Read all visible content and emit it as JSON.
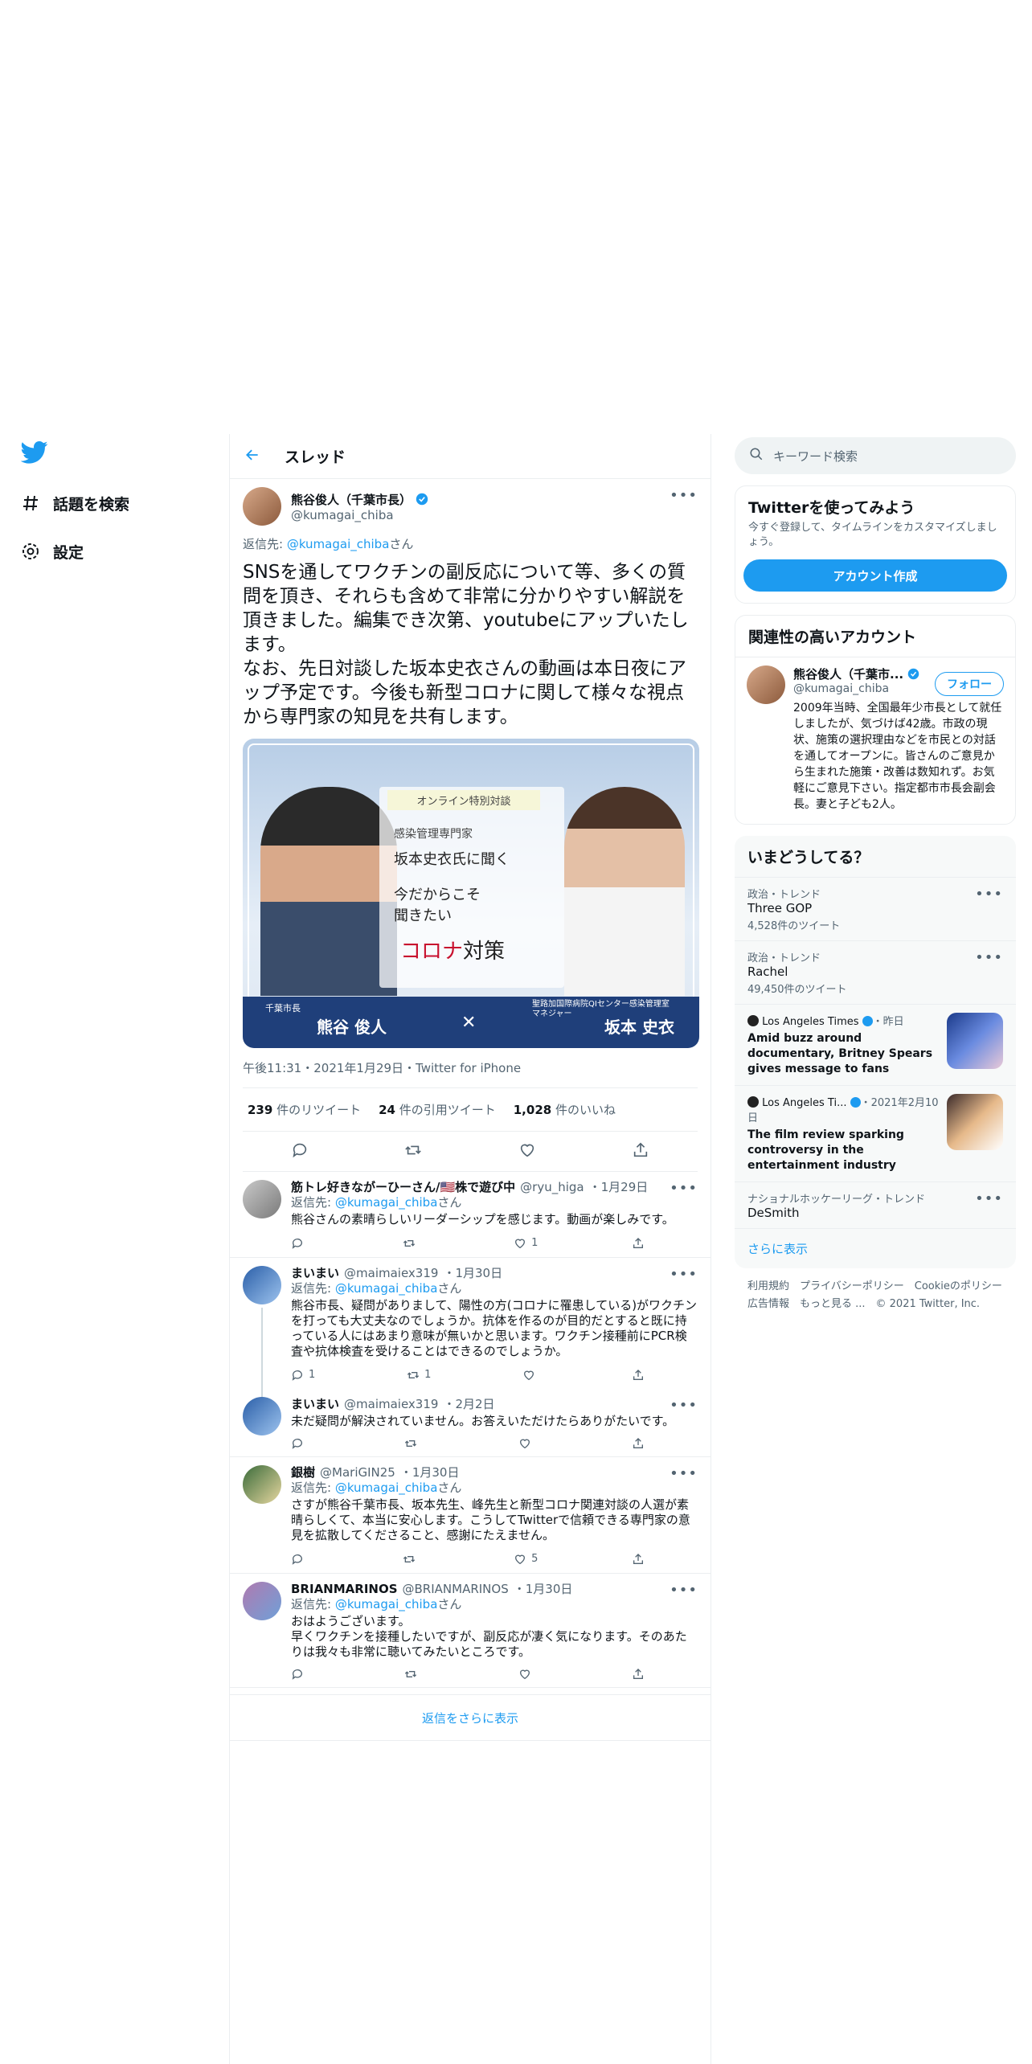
{
  "nav": {
    "search_label": "話題を検索",
    "settings_label": "設定"
  },
  "header": {
    "title": "スレッド"
  },
  "main_tweet": {
    "name": "熊谷俊人（千葉市長）",
    "handle": "@kumagai_chiba",
    "reply_prefix": "返信先: ",
    "reply_handle": "@kumagai_chiba",
    "reply_suffix": "さん",
    "text": "SNSを通してワクチンの副反応について等、多くの質問を頂き、それらも含めて非常に分かりやすい解説を頂きました。編集でき次第、youtubeにアップいたします。\nなお、先日対談した坂本史衣さんの動画は本日夜にアップ予定です。今後も新型コロナに関して様々な視点から専門家の知見を共有します。",
    "media": {
      "banner": "オンライン特別対談",
      "subtitle": "感染管理専門家",
      "headline": "坂本史衣氏に聞く",
      "line1": "今だからこそ",
      "line2": "聞きたい",
      "topic_red": "コロナ",
      "topic_black": "対策",
      "left_role": "千葉市長",
      "left_name": "熊谷 俊人",
      "x": "✕",
      "right_role": "聖路加国際病院QIセンター感染管理室\nマネジャー",
      "right_name": "坂本 史衣"
    },
    "meta": "午後11:31・2021年1月29日・Twitter for iPhone",
    "retweets": "239",
    "retweets_label": " 件のリツイート",
    "quotes": "24",
    "quotes_label": " 件の引用ツイート",
    "likes": "1,028",
    "likes_label": " 件のいいね"
  },
  "replies": [
    {
      "name": "筋トレ好きながーひーさん/🇺🇸株で遊び中",
      "handle": "@ryu_higa",
      "date": "・1月29日",
      "reply_prefix": "返信先: ",
      "reply_handle": "@kumagai_chiba",
      "reply_suffix": "さん",
      "text": "熊谷さんの素晴らしいリーダーシップを感じます。動画が楽しみです。",
      "replies": "",
      "retweets": "",
      "likes": "1"
    },
    {
      "name": "まいまい",
      "handle": "@maimaiex319",
      "date": "・1月30日",
      "reply_prefix": "返信先: ",
      "reply_handle": "@kumagai_chiba",
      "reply_suffix": "さん",
      "text": "熊谷市長、疑問がありまして、陽性の方(コロナに罹患している)がワクチンを打っても大丈夫なのでしょうか。抗体を作るのが目的だとすると既に持っている人にはあまり意味が無いかと思います。ワクチン接種前にPCR検査や抗体検査を受けることはできるのでしょうか。",
      "replies": "1",
      "retweets": "1",
      "likes": ""
    },
    {
      "name": "まいまい",
      "handle": "@maimaiex319",
      "date": "・2月2日",
      "reply_prefix": "",
      "reply_handle": "",
      "reply_suffix": "",
      "text": "未だ疑問が解決されていません。お答えいただけたらありがたいです。",
      "replies": "",
      "retweets": "",
      "likes": ""
    },
    {
      "name": "銀樹",
      "handle": "@MariGIN25",
      "date": "・1月30日",
      "reply_prefix": "返信先: ",
      "reply_handle": "@kumagai_chiba",
      "reply_suffix": "さん",
      "text": "さすが熊谷千葉市長、坂本先生、峰先生と新型コロナ関連対談の人選が素晴らしくて、本当に安心します。こうしてTwitterで信頼できる専門家の意見を拡散してくださること、感謝にたえません。",
      "replies": "",
      "retweets": "",
      "likes": "5"
    },
    {
      "name": "BRIANMARINOS",
      "handle": "@BRIANMARINOS",
      "date": "・1月30日",
      "reply_prefix": "返信先: ",
      "reply_handle": "@kumagai_chiba",
      "reply_suffix": "さん",
      "text": "おはようございます。\n早くワクチンを接種したいですが、副反応が凄く気になります。そのあたりは我々も非常に聴いてみたいところです。",
      "replies": "",
      "retweets": "",
      "likes": ""
    }
  ],
  "show_more_replies": "返信をさらに表示",
  "search": {
    "placeholder": "キーワード検索"
  },
  "signup": {
    "title": "Twitterを使ってみよう",
    "desc": "今すぐ登録して、タイムラインをカスタマイズしましょう。",
    "button": "アカウント作成"
  },
  "related": {
    "title": "関連性の高いアカウント",
    "name": "熊谷俊人（千葉市...",
    "handle": "@kumagai_chiba",
    "follow": "フォロー",
    "bio": "2009年当時、全国最年少市長として就任しましたが、気づけば42歳。市政の現状、施策の選択理由などを市民との対話を通してオープンに。皆さんのご意見から生まれた施策・改善は数知れず。お気軽にご意見下さい。指定都市市長会副会長。妻と子ども2人。"
  },
  "trends": {
    "title": "いまどうしてる？",
    "items": [
      {
        "cat": "政治・トレンド",
        "name": "Three GOP",
        "count": "4,528件のツイート"
      },
      {
        "cat": "政治・トレンド",
        "name": "Rachel",
        "count": "49,450件のツイート"
      }
    ],
    "news": [
      {
        "source": "Los Angeles Times",
        "date": "・昨日",
        "text": "Amid buzz around documentary, Britney Spears gives message to fans"
      },
      {
        "source": "Los Angeles Ti...",
        "date": "・2021年2月10日",
        "text": "The film review sparking controversy in the entertainment industry"
      }
    ],
    "last": {
      "cat": "ナショナルホッケーリーグ・トレンド",
      "name": "DeSmith"
    },
    "show_more": "さらに表示"
  },
  "footer": {
    "line1": "利用規約　プライバシーポリシー　Cookieのポリシー",
    "line2": "広告情報　もっと見る ...　© 2021 Twitter, Inc."
  },
  "colors": {
    "accent": "#1d9bf0"
  }
}
